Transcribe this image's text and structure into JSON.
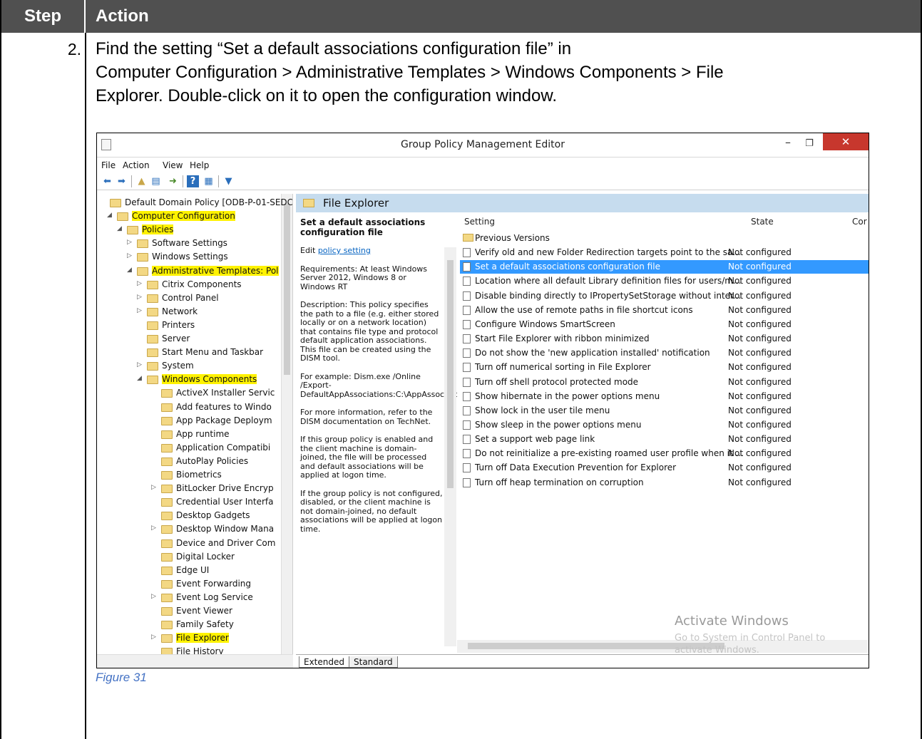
{
  "table": {
    "header_step": "Step",
    "header_action": "Action",
    "step_number": "2.",
    "instruction_line1": "Find the setting “Set a default associations configuration file” in",
    "instruction_line2": "Computer Configuration > Administrative Templates > Windows Components > File",
    "instruction_line3": "Explorer. Double-click on it to open the configuration window.",
    "caption": "Figure 31"
  },
  "window": {
    "title": "Group Policy Management Editor",
    "minimize": "–",
    "maximize": "❐",
    "close": "✕",
    "menu": [
      "File",
      "Action",
      "View",
      "Help"
    ]
  },
  "tree": [
    {
      "label": "Default Domain Policy [ODB-P-01-SEDC.",
      "arrow": "",
      "hl": false
    },
    {
      "label": "Computer Configuration",
      "arrow": "◢",
      "hl": true
    },
    {
      "label": "Policies",
      "arrow": "◢",
      "hl": true
    },
    {
      "label": "Software Settings",
      "arrow": "▷",
      "hl": false
    },
    {
      "label": "Windows Settings",
      "arrow": "▷",
      "hl": false
    },
    {
      "label": "Administrative Templates: Pol",
      "arrow": "◢",
      "hl": true
    },
    {
      "label": "Citrix Components",
      "arrow": "▷",
      "hl": false
    },
    {
      "label": "Control Panel",
      "arrow": "▷",
      "hl": false
    },
    {
      "label": "Network",
      "arrow": "▷",
      "hl": false
    },
    {
      "label": "Printers",
      "arrow": "",
      "hl": false
    },
    {
      "label": "Server",
      "arrow": "",
      "hl": false
    },
    {
      "label": "Start Menu and Taskbar",
      "arrow": "",
      "hl": false
    },
    {
      "label": "System",
      "arrow": "▷",
      "hl": false
    },
    {
      "label": "Windows Components",
      "arrow": "◢",
      "hl": true
    },
    {
      "label": "ActiveX Installer Servic",
      "arrow": "",
      "hl": false
    },
    {
      "label": "Add features to Windo",
      "arrow": "",
      "hl": false
    },
    {
      "label": "App Package Deploym",
      "arrow": "",
      "hl": false
    },
    {
      "label": "App runtime",
      "arrow": "",
      "hl": false
    },
    {
      "label": "Application Compatibi",
      "arrow": "",
      "hl": false
    },
    {
      "label": "AutoPlay Policies",
      "arrow": "",
      "hl": false
    },
    {
      "label": "Biometrics",
      "arrow": "",
      "hl": false
    },
    {
      "label": "BitLocker Drive Encryp",
      "arrow": "▷",
      "hl": false
    },
    {
      "label": "Credential User Interfa",
      "arrow": "",
      "hl": false
    },
    {
      "label": "Desktop Gadgets",
      "arrow": "",
      "hl": false
    },
    {
      "label": "Desktop Window Mana",
      "arrow": "▷",
      "hl": false
    },
    {
      "label": "Device and Driver Com",
      "arrow": "",
      "hl": false
    },
    {
      "label": "Digital Locker",
      "arrow": "",
      "hl": false
    },
    {
      "label": "Edge UI",
      "arrow": "",
      "hl": false
    },
    {
      "label": "Event Forwarding",
      "arrow": "",
      "hl": false
    },
    {
      "label": "Event Log Service",
      "arrow": "▷",
      "hl": false
    },
    {
      "label": "Event Viewer",
      "arrow": "",
      "hl": false
    },
    {
      "label": "Family Safety",
      "arrow": "",
      "hl": false
    },
    {
      "label": "File Explorer",
      "arrow": "▷",
      "hl": true
    },
    {
      "label": "File History",
      "arrow": "",
      "hl": false
    }
  ],
  "panel": {
    "title": "File Explorer",
    "desc_title": "Set a default associations configuration file",
    "edit_prefix": "Edit ",
    "edit_link": "policy setting",
    "requirements": "Requirements: At least Windows Server 2012, Windows 8 or Windows RT",
    "description": "Description: This policy specifies the path to a file (e.g. either stored locally or on a network location) that contains file type and protocol default application associations. This file can be created using the DISM tool.",
    "example": "For example: Dism.exe /Online /Export-DefaultAppAssociations:C:\\AppAssoc.txt",
    "more_info": "For more information, refer to the DISM documentation on TechNet.",
    "enabled": "If this group policy is enabled and the client machine is domain-joined, the file will be processed and default associations will be applied at logon time.",
    "not_configured": "If the group policy is not configured, disabled, or the client machine is not domain-joined, no default associations will be applied at logon time."
  },
  "list": {
    "col_setting": "Setting",
    "col_state": "State",
    "col_comment": "Cor",
    "rows": [
      {
        "name": "Previous Versions",
        "state": "",
        "folder": true,
        "selected": false
      },
      {
        "name": "Verify old and new Folder Redirection targets point to the sa...",
        "state": "Not configured",
        "folder": false,
        "selected": false
      },
      {
        "name": "Set a default associations configuration file",
        "state": "Not configured",
        "folder": false,
        "selected": true
      },
      {
        "name": "Location where all default Library definition files for users/m...",
        "state": "Not configured",
        "folder": false,
        "selected": false
      },
      {
        "name": "Disable binding directly to IPropertySetStorage without inter...",
        "state": "Not configured",
        "folder": false,
        "selected": false
      },
      {
        "name": "Allow the use of remote paths in file shortcut icons",
        "state": "Not configured",
        "folder": false,
        "selected": false
      },
      {
        "name": "Configure Windows SmartScreen",
        "state": "Not configured",
        "folder": false,
        "selected": false
      },
      {
        "name": "Start File Explorer with ribbon minimized",
        "state": "Not configured",
        "folder": false,
        "selected": false
      },
      {
        "name": "Do not show the 'new application installed' notification",
        "state": "Not configured",
        "folder": false,
        "selected": false
      },
      {
        "name": "Turn off numerical sorting in File Explorer",
        "state": "Not configured",
        "folder": false,
        "selected": false
      },
      {
        "name": "Turn off shell protocol protected mode",
        "state": "Not configured",
        "folder": false,
        "selected": false
      },
      {
        "name": "Show hibernate in the power options menu",
        "state": "Not configured",
        "folder": false,
        "selected": false
      },
      {
        "name": "Show lock in the user tile menu",
        "state": "Not configured",
        "folder": false,
        "selected": false
      },
      {
        "name": "Show sleep in the power options menu",
        "state": "Not configured",
        "folder": false,
        "selected": false
      },
      {
        "name": "Set a support web page link",
        "state": "Not configured",
        "folder": false,
        "selected": false
      },
      {
        "name": "Do not reinitialize a pre-existing roamed user profile when it ...",
        "state": "Not configured",
        "folder": false,
        "selected": false
      },
      {
        "name": "Turn off Data Execution Prevention for Explorer",
        "state": "Not configured",
        "folder": false,
        "selected": false
      },
      {
        "name": "Turn off heap termination on corruption",
        "state": "Not configured",
        "folder": false,
        "selected": false
      }
    ]
  },
  "watermark": {
    "line1": "Activate Windows",
    "line2": "Go to System in Control Panel to activate Windows."
  },
  "tabs": [
    "Extended",
    "Standard"
  ],
  "colors": {
    "header_bg": "#505050",
    "highlight": "#fff200",
    "selection": "#3399ff",
    "caption": "#4472c4"
  }
}
